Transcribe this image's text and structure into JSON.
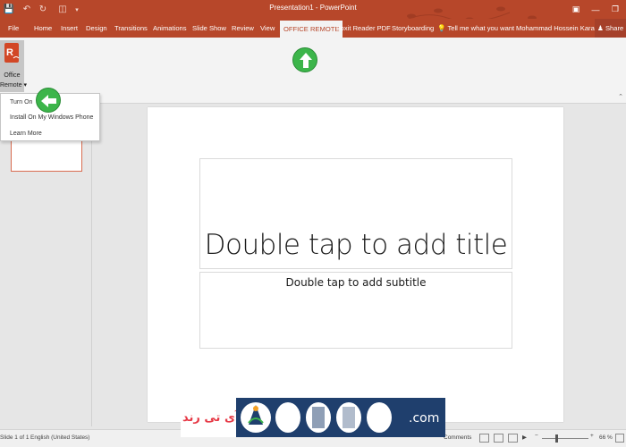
{
  "window": {
    "title": "Presentation1 - PowerPoint"
  },
  "tabs": [
    {
      "label": "File"
    },
    {
      "label": "Home"
    },
    {
      "label": "Insert"
    },
    {
      "label": "Design"
    },
    {
      "label": "Transitions"
    },
    {
      "label": "Animations"
    },
    {
      "label": "Slide Show"
    },
    {
      "label": "Review"
    },
    {
      "label": "View"
    },
    {
      "label": "OFFICE REMOTE",
      "active": true
    },
    {
      "label": "Foxit Reader PDF"
    },
    {
      "label": "Storyboarding"
    }
  ],
  "tell_me": "Tell me what you want to do",
  "user": "Mohammad Hossein Karami",
  "share": "Share",
  "ribbon": {
    "office_remote_line1": "Office",
    "office_remote_line2": "Remote"
  },
  "dropdown": {
    "items": [
      {
        "label": "Turn On"
      },
      {
        "label": "Install On My Windows Phone"
      },
      {
        "label": "Learn More"
      }
    ]
  },
  "slide": {
    "title_placeholder": "Double tap to add title",
    "subtitle_placeholder": "Double tap to add subtitle"
  },
  "statusbar": {
    "slide_info": "Slide 1 of 1",
    "language": "English (United States)",
    "comments": "Comments",
    "zoom": "66 %"
  },
  "watermark": {
    "fa_text": "آی تی رند",
    "com_text": ".com"
  },
  "colors": {
    "accent": "#b7472a",
    "arrow": "#3cb54a"
  }
}
